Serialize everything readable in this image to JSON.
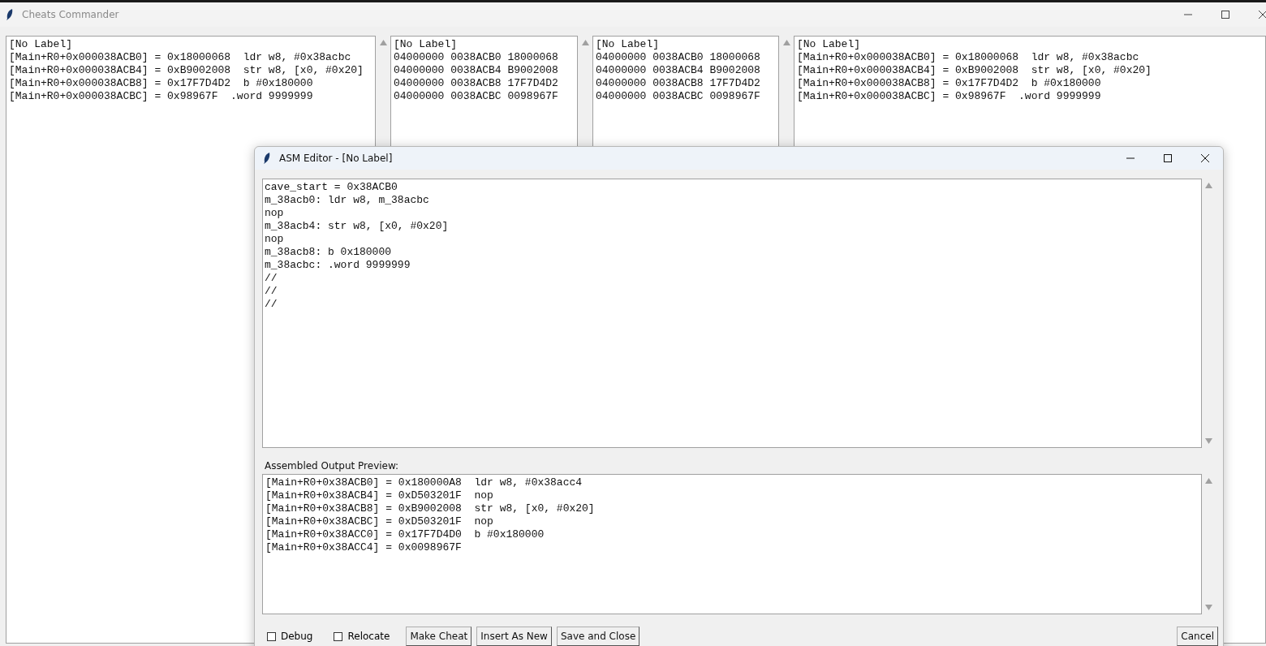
{
  "window": {
    "title": "Cheats Commander"
  },
  "panes": [
    {
      "lines": [
        "[No Label]",
        "[Main+R0+0x000038ACB0] = 0x18000068  ldr w8, #0x38acbc",
        "[Main+R0+0x000038ACB4] = 0xB9002008  str w8, [x0, #0x20]",
        "[Main+R0+0x000038ACB8] = 0x17F7D4D2  b #0x180000",
        "[Main+R0+0x000038ACBC] = 0x98967F  .word 9999999"
      ]
    },
    {
      "lines": [
        "[No Label]",
        "04000000 0038ACB0 18000068",
        "04000000 0038ACB4 B9002008",
        "04000000 0038ACB8 17F7D4D2",
        "04000000 0038ACBC 0098967F"
      ]
    },
    {
      "lines": [
        "[No Label]",
        "04000000 0038ACB0 18000068",
        "04000000 0038ACB4 B9002008",
        "04000000 0038ACB8 17F7D4D2",
        "04000000 0038ACBC 0098967F"
      ]
    },
    {
      "lines": [
        "[No Label]",
        "[Main+R0+0x000038ACB0] = 0x18000068  ldr w8, #0x38acbc",
        "[Main+R0+0x000038ACB4] = 0xB9002008  str w8, [x0, #0x20]",
        "[Main+R0+0x000038ACB8] = 0x17F7D4D2  b #0x180000",
        "[Main+R0+0x000038ACBC] = 0x98967F  .word 9999999"
      ]
    }
  ],
  "asm_editor": {
    "title": "ASM Editor - [No Label]",
    "source_lines": [
      "cave_start = 0x38ACB0",
      "m_38acb0: ldr w8, m_38acbc",
      "nop",
      "m_38acb4: str w8, [x0, #0x20]",
      "nop",
      "m_38acb8: b 0x180000",
      "m_38acbc: .word 9999999",
      "//",
      "//",
      "//"
    ],
    "output_label": "Assembled Output Preview:",
    "output_lines": [
      "[Main+R0+0x38ACB0] = 0x180000A8  ldr w8, #0x38acc4",
      "[Main+R0+0x38ACB4] = 0xD503201F  nop",
      "[Main+R0+0x38ACB8] = 0xB9002008  str w8, [x0, #0x20]",
      "[Main+R0+0x38ACBC] = 0xD503201F  nop",
      "[Main+R0+0x38ACC0] = 0x17F7D4D0  b #0x180000",
      "[Main+R0+0x38ACC4] = 0x0098967F"
    ],
    "options": [
      {
        "label": "Debug",
        "checked": false
      },
      {
        "label": "Relocate",
        "checked": false
      }
    ],
    "buttons": [
      "Make Cheat",
      "Insert As New",
      "Save and Close"
    ],
    "cancel": "Cancel"
  }
}
